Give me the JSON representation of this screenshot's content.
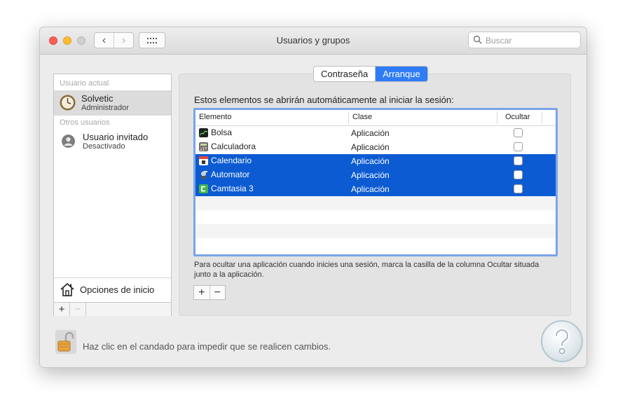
{
  "window": {
    "title": "Usuarios y grupos",
    "search_placeholder": "Buscar"
  },
  "sidebar": {
    "current_user_label": "Usuario actual",
    "current_user": {
      "name": "Solvetic",
      "role": "Administrador"
    },
    "other_users_label": "Otros usuarios",
    "other_users": [
      {
        "name": "Usuario invitado",
        "role": "Desactivado"
      }
    ],
    "login_options": "Opciones de inicio",
    "add": "+",
    "remove": "−"
  },
  "tabs": [
    {
      "label": "Contraseña",
      "active": false
    },
    {
      "label": "Arranque",
      "active": true
    }
  ],
  "startup": {
    "intro": "Estos elementos se abrirán automáticamente al iniciar la sesión:",
    "columns": {
      "item": "Elemento",
      "kind": "Clase",
      "hide": "Ocultar"
    },
    "rows": [
      {
        "name": "Bolsa",
        "kind": "Aplicación",
        "selected": false,
        "icon": "stocks-icon"
      },
      {
        "name": "Calculadora",
        "kind": "Aplicación",
        "selected": false,
        "icon": "calculator-icon"
      },
      {
        "name": "Calendario",
        "kind": "Aplicación",
        "selected": true,
        "icon": "calendar-icon"
      },
      {
        "name": "Automator",
        "kind": "Aplicación",
        "selected": true,
        "icon": "automator-icon"
      },
      {
        "name": "Camtasia 3",
        "kind": "Aplicación",
        "selected": true,
        "icon": "camtasia-icon"
      }
    ],
    "help_text": "Para ocultar una aplicación cuando inicies una sesión, marca la casilla de la columna Ocultar situada junto a la aplicación.",
    "add": "+",
    "remove": "−"
  },
  "footer": {
    "lock_text": "Haz clic en el candado para impedir que se realicen cambios."
  },
  "colors": {
    "accent": "#2f7cf6",
    "selection": "#0c5bd2"
  }
}
